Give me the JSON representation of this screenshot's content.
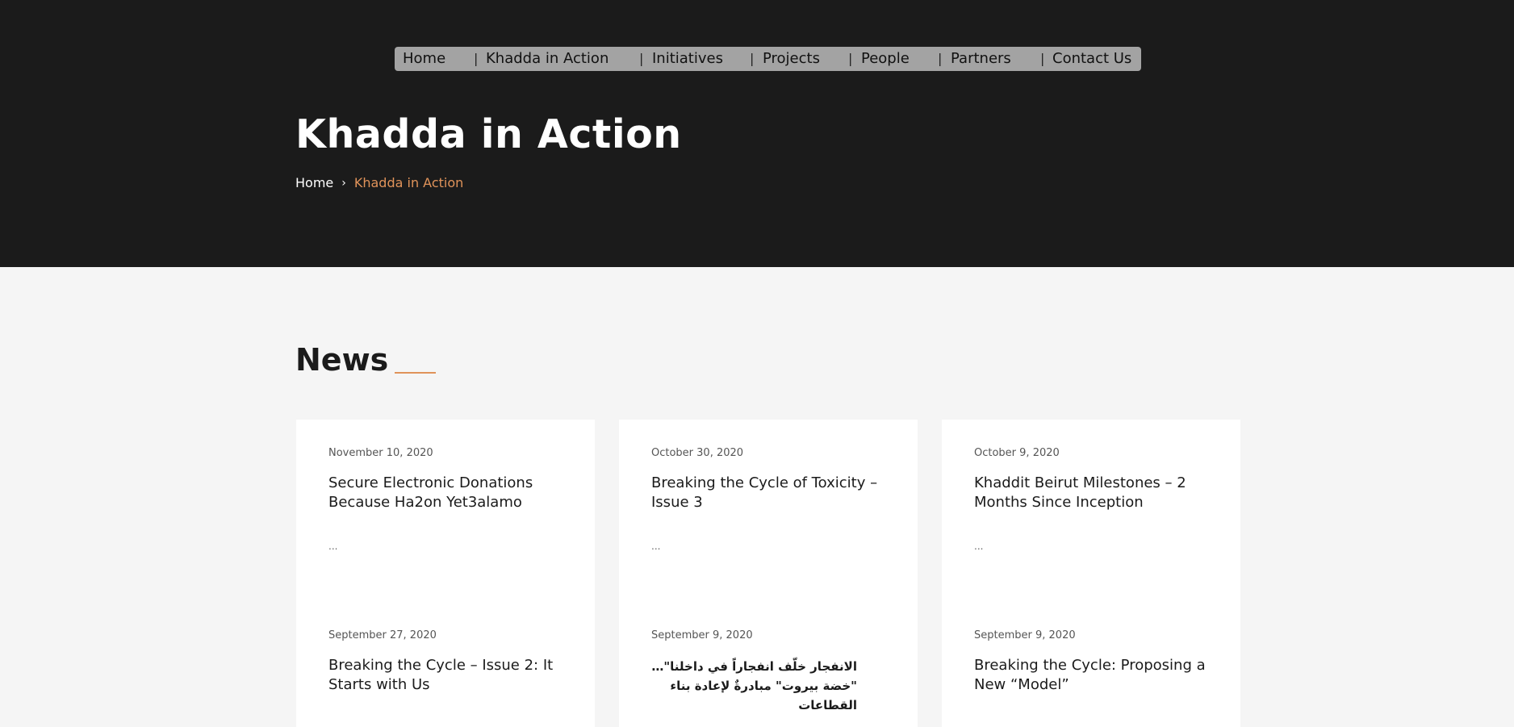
{
  "nav": {
    "items": [
      "Home",
      "Khadda in Action",
      "Initiatives",
      "Projects",
      "People",
      "Partners",
      "Contact Us"
    ],
    "separator": "|"
  },
  "hero": {
    "title": "Khadda in Action",
    "breadcrumb": {
      "home": "Home",
      "chevron": "›",
      "current": "Khadda in Action"
    }
  },
  "news": {
    "heading": "News",
    "posts": [
      {
        "date": "November 10, 2020",
        "title": "Secure Electronic Donations Because Ha2on Yet3alamo",
        "excerpt": "..."
      },
      {
        "date": "October 30, 2020",
        "title": "Breaking the Cycle of Toxicity – Issue 3",
        "excerpt": "..."
      },
      {
        "date": "October 9, 2020",
        "title": "Khaddit Beirut Milestones – 2 Months Since Inception",
        "excerpt": "..."
      },
      {
        "date": "September 27, 2020",
        "title": "Breaking the Cycle – Issue 2: It Starts with Us"
      },
      {
        "date": "September 9, 2020",
        "title": "الانفجار خلّف انفجاراً في داخلنا\"… \"خضة بيروت\" مبادرةٌ لإعادة بناء القطاعات"
      },
      {
        "date": "September 9, 2020",
        "title": "Breaking the Cycle: Proposing a New “Model”"
      }
    ]
  },
  "colors": {
    "hero_bg": "#1b1b1b",
    "nav_bg": "#a3a3a3",
    "accent": "#e0935a",
    "page_bg": "#f5f5f5",
    "card_bg": "#ffffff"
  }
}
